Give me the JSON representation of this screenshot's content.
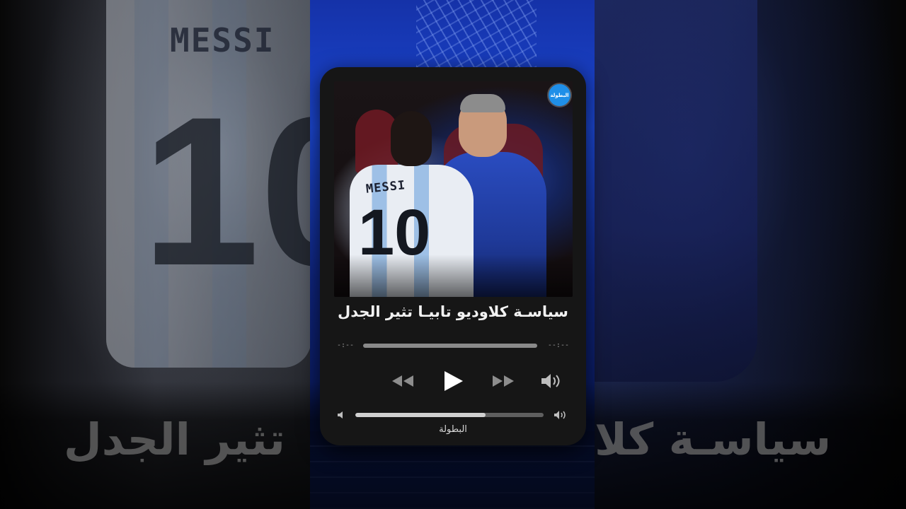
{
  "card": {
    "title": "سياسـة كلاوديو تابيـا تثير الجدل",
    "badge_label": "البطولة",
    "source_label": "البطولة"
  },
  "artwork": {
    "jersey_name": "MESSI",
    "jersey_number": "10"
  },
  "player": {
    "elapsed_time": "-:--",
    "remaining_time": "--:--",
    "volume_level": 0.69,
    "controls": [
      "rewind-icon",
      "play-icon",
      "fast-forward-icon",
      "volume-icon"
    ]
  },
  "background": {
    "caption_left": "تثير الجدل",
    "caption_right": "سياسـة كلا",
    "jersey_name": "MESSI",
    "jersey_number": "10"
  },
  "colors": {
    "badge": "#1f8fe8",
    "card": "#161616",
    "accent_blue": "#1b46d0"
  }
}
